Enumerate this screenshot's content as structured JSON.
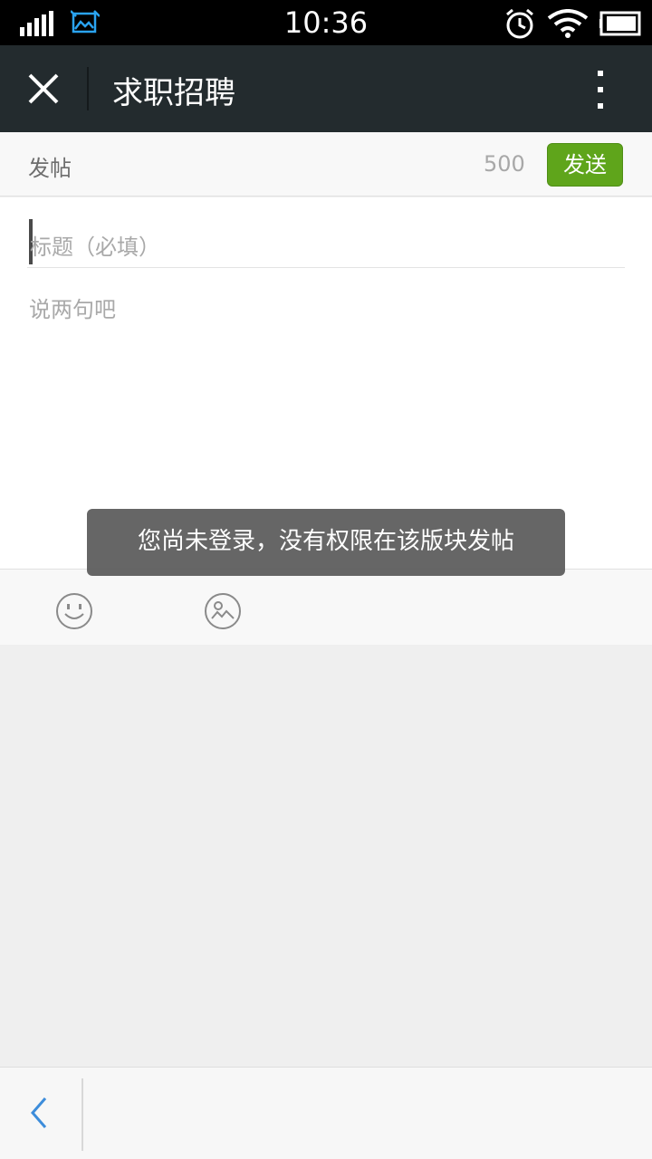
{
  "status_bar": {
    "time": "10:36",
    "icons": [
      "signal-icon",
      "gallery-icon",
      "alarm-icon",
      "wifi-icon",
      "battery-icon"
    ]
  },
  "header": {
    "title": "求职招聘",
    "close_icon": "close-icon",
    "more_icon": "more-vertical-icon"
  },
  "compose": {
    "label": "发帖",
    "char_count": "500",
    "send_label": "发送",
    "accent_color": "#5fa51b"
  },
  "editor": {
    "title_placeholder": "标题（必填）",
    "body_placeholder": "说两句吧"
  },
  "toast": {
    "message": "您尚未登录，没有权限在该版块发帖"
  },
  "toolbar": {
    "items": [
      "emoji-icon",
      "image-icon"
    ]
  },
  "bottom_nav": {
    "back_icon": "chevron-left-icon"
  }
}
